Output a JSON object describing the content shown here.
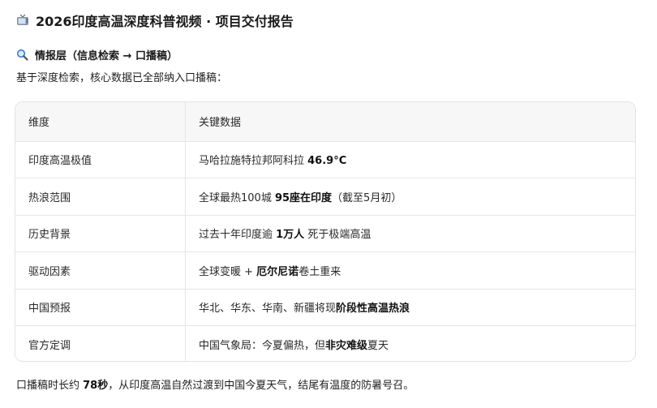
{
  "title": {
    "text": "2026印度高温深度科普视频 · 项目交付报告"
  },
  "section": {
    "title": "情报层（信息检索 → 口播稿）"
  },
  "intro": {
    "text": "基于深度检索，核心数据已全部纳入口播稿："
  },
  "table": {
    "headers": [
      "维度",
      "关键数据"
    ],
    "rows": [
      {
        "dimension": "印度高温极值",
        "pre": "马哈拉施特拉邦阿科拉 ",
        "bold": "46.9°C",
        "post": ""
      },
      {
        "dimension": "热浪范围",
        "pre": "全球最热100城 ",
        "bold": "95座在印度",
        "post": "（截至5月初）"
      },
      {
        "dimension": "历史背景",
        "pre": "过去十年印度逾 ",
        "bold": "1万人",
        "post": " 死于极端高温"
      },
      {
        "dimension": "驱动因素",
        "pre": "全球变暖 + ",
        "bold": "厄尔尼诺",
        "post": "卷土重来"
      },
      {
        "dimension": "中国预报",
        "pre": "华北、华东、华南、新疆将现",
        "bold": "阶段性高温热浪",
        "post": ""
      },
      {
        "dimension": "官方定调",
        "pre": "中国气象局：今夏偏热，但",
        "bold": "非灾难级",
        "post": "夏天"
      }
    ]
  },
  "outro": {
    "pre": "口播稿时长约 ",
    "bold": "78秒",
    "post": "，从印度高温自然过渡到中国今夏天气，结尾有温度的防暑号召。"
  },
  "icons": {
    "title_icon": "tv-icon",
    "section_icon": "magnifier-icon"
  },
  "colors": {
    "header_bg": "#f7f7f8",
    "border": "#e6e6e6"
  }
}
